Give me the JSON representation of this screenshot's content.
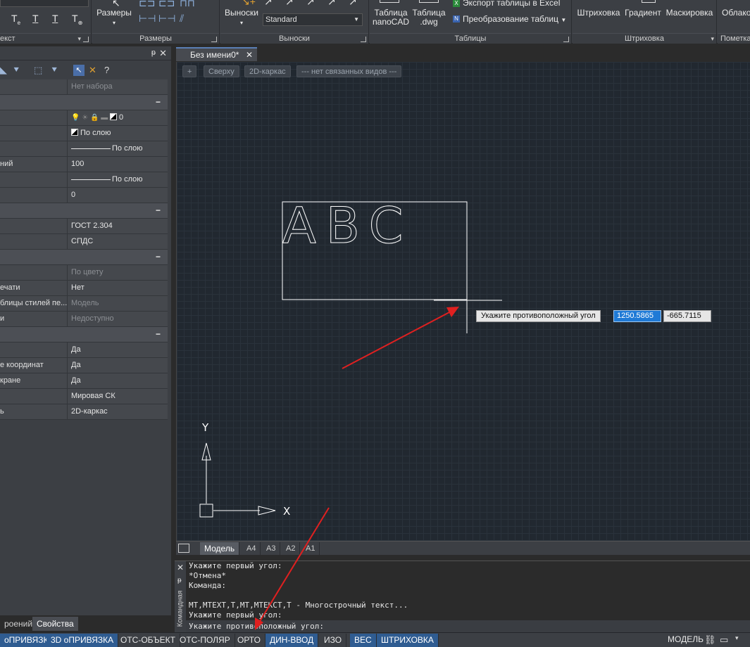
{
  "ribbon": {
    "text_group_title": "екст",
    "dims_button_label": "Размеры",
    "dims_group_title": "Размеры",
    "callouts_button_label": "Выноски",
    "callout_style_value": "Standard",
    "callouts_group_title": "Выноски",
    "table_nanocad_label": "Таблица nanoCAD",
    "table_dwg_label": "Таблица .dwg",
    "export_excel_label": "Экспорт таблицы в Excel",
    "convert_tables_label": "Преобразование таблиц",
    "tables_group_title": "Таблицы",
    "hatch_label": "Штриховка",
    "gradient_label": "Градиент",
    "mask_label": "Маскировка",
    "hatch_group_title": "Штриховка",
    "cloud_label": "Облако",
    "markup_group_title": "Пометка"
  },
  "properties": {
    "rows": [
      {
        "kind": "row",
        "name": "",
        "value": "Нет набора",
        "dim": true
      },
      {
        "kind": "cat",
        "name": ""
      },
      {
        "kind": "row",
        "name": "",
        "value": "0",
        "layer": true
      },
      {
        "kind": "row",
        "name": "",
        "value": "По слою",
        "bw": true
      },
      {
        "kind": "row",
        "name": "",
        "value": "По слою",
        "line": true
      },
      {
        "kind": "row",
        "name": "ний",
        "value": "100"
      },
      {
        "kind": "row",
        "name": "",
        "value": "По слою",
        "line": true
      },
      {
        "kind": "row",
        "name": "",
        "value": "0"
      },
      {
        "kind": "cat",
        "name": ""
      },
      {
        "kind": "row",
        "name": "",
        "value": "ГОСТ 2.304"
      },
      {
        "kind": "row",
        "name": "",
        "value": "СПДС"
      },
      {
        "kind": "cat",
        "name": ""
      },
      {
        "kind": "row",
        "name": "",
        "value": "По цвету",
        "dim": true
      },
      {
        "kind": "row",
        "name": "ечати",
        "value": "Нет"
      },
      {
        "kind": "row",
        "name": "блицы стилей пе...",
        "value": "Модель",
        "dim": true
      },
      {
        "kind": "row",
        "name": "и",
        "value": "Недоступно",
        "dim": true
      },
      {
        "kind": "cat",
        "name": ""
      },
      {
        "kind": "row",
        "name": "",
        "value": "Да"
      },
      {
        "kind": "row",
        "name": "е координат",
        "value": "Да"
      },
      {
        "kind": "row",
        "name": "кране",
        "value": "Да"
      },
      {
        "kind": "row",
        "name": "",
        "value": "Мировая СК"
      },
      {
        "kind": "row",
        "name": "ь",
        "value": "2D-каркас"
      }
    ],
    "tab_structure": "роений",
    "tab_properties": "Свойства"
  },
  "document": {
    "tab_title": "Без имени0*",
    "viewport_plus": "+",
    "viewport_view": "Сверху",
    "viewport_style": "2D-каркас",
    "viewport_linked": "--- нет связанных видов ---",
    "drawn_text": "ABC",
    "axis_y": "Y",
    "axis_x": "X"
  },
  "dynamic_input": {
    "prompt": "Укажите противоположный угол",
    "x_value": "1250.5865",
    "y_value": "-665.7115"
  },
  "layouts": {
    "tabs": [
      "Модель",
      "A4",
      "A3",
      "A2",
      "A1"
    ]
  },
  "command": {
    "title": "Командная",
    "history": "Укажите первый угол:\n*Отмена*\nКоманда:\n\nMT,MTEXT,T,MT,MTEKCT,T - Многострочный текст...\nУкажите первый угол:",
    "current": "Укажите противоположный угол:"
  },
  "status": {
    "items": [
      {
        "label": "оПРИВЯЗКА",
        "on": true
      },
      {
        "label": "3D оПРИВЯЗКА",
        "on": true
      },
      {
        "label": "ОТС-ОБЪЕКТ",
        "on": false
      },
      {
        "label": "ОТС-ПОЛЯР",
        "on": false
      },
      {
        "label": "ОРТО",
        "on": false
      },
      {
        "label": "ДИН-ВВОД",
        "on": true
      },
      {
        "label": "ИЗО",
        "on": false
      },
      {
        "label": "ВЕС",
        "on": true
      },
      {
        "label": "ШТРИХОВКА",
        "on": true
      }
    ],
    "space": "МОДЕЛЬ"
  },
  "colors": {
    "canvas": "#212830",
    "status_on": "#2f5c91",
    "dyn_input_active": "#1f7ad6",
    "annotation_arrow": "#e02020"
  }
}
